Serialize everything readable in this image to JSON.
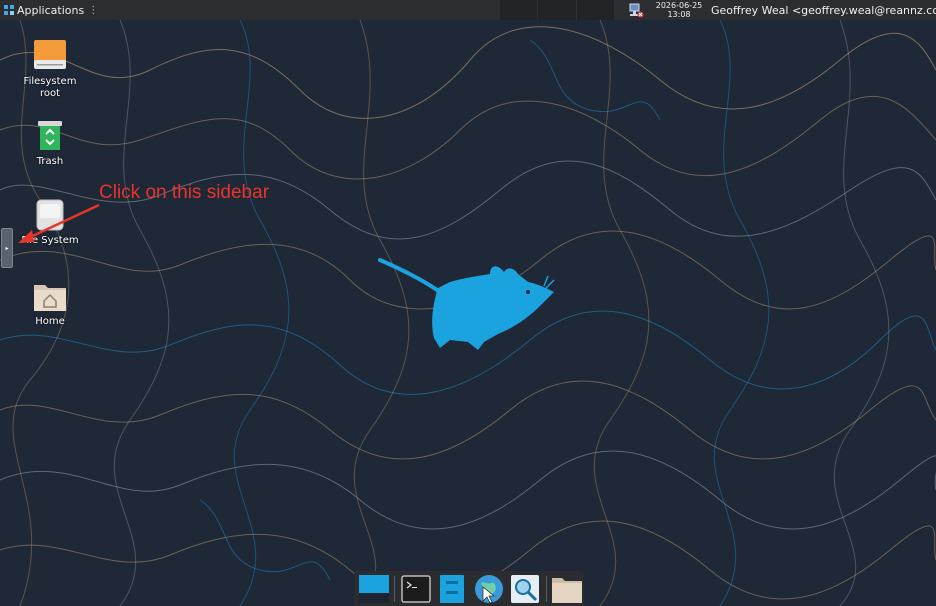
{
  "panel": {
    "applications_label": "Applications",
    "menu_separator": "⋮",
    "clock_date": "2026-06-25",
    "clock_time": "13:08",
    "user_label": "Geoffrey Weal <geoffrey.weal@reannz.co.nz>"
  },
  "desktop_icons": [
    {
      "label": "Filesystem root",
      "icon": "drive-icon"
    },
    {
      "label": "Trash",
      "icon": "trash-icon"
    },
    {
      "label": "File System",
      "icon": "filesystem-icon"
    },
    {
      "label": "Home",
      "icon": "home-folder-icon"
    }
  ],
  "annotation": {
    "text": "Click on this sidebar",
    "color": "#e8342a"
  },
  "dock": {
    "items": [
      "show-desktop-icon",
      "terminal-icon",
      "file-manager-icon",
      "web-browser-icon",
      "app-finder-icon",
      "folder-icon"
    ]
  },
  "colors": {
    "background": "#1f2837",
    "panel": "#2b2d31",
    "accent": "#1aa3df"
  }
}
